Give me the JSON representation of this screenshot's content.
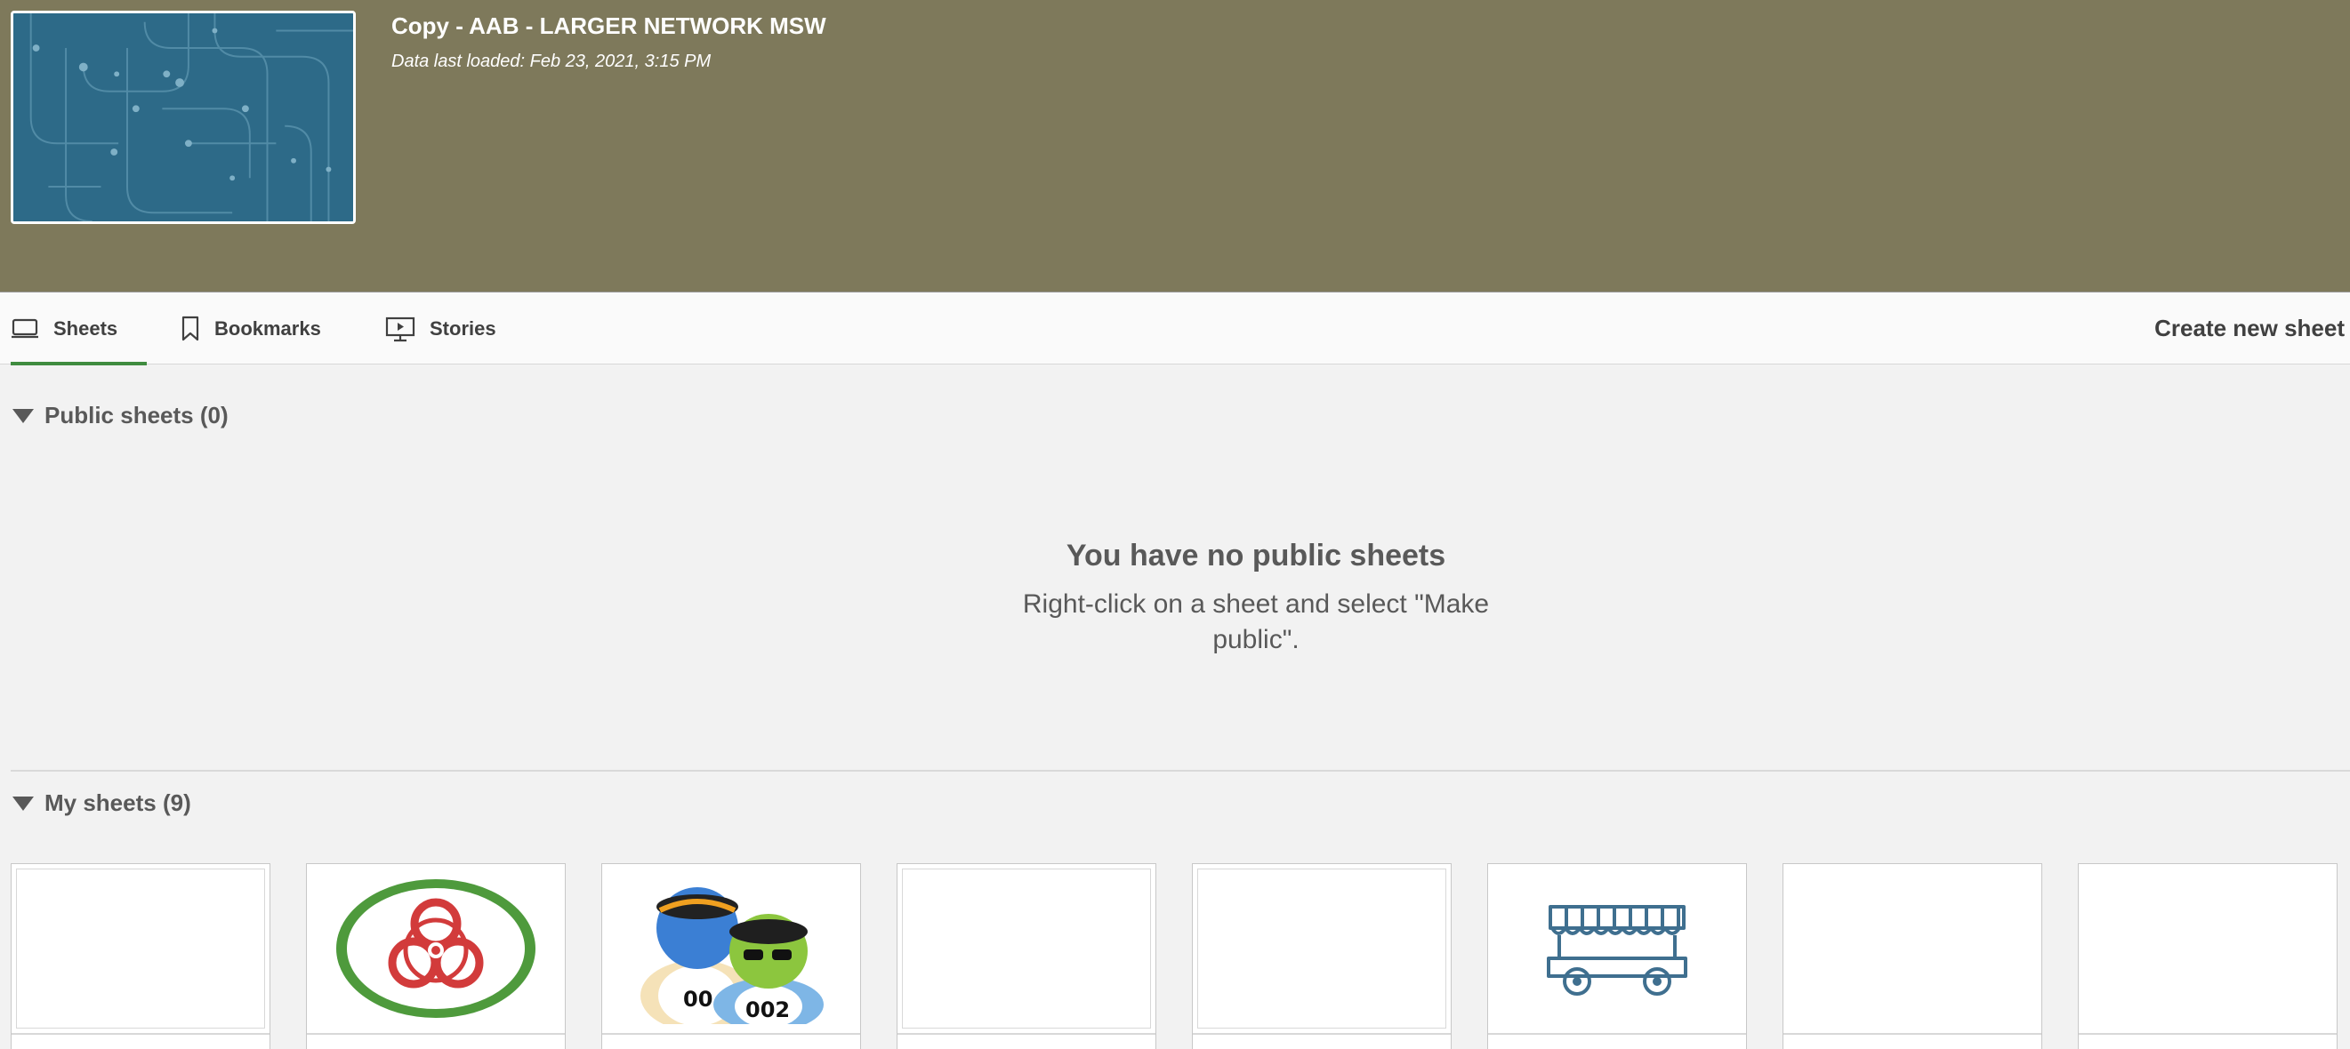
{
  "app": {
    "title": "Copy - AAB - LARGER NETWORK MSW",
    "data_loaded": "Data last loaded: Feb 23, 2021, 3:15 PM"
  },
  "tabs": [
    {
      "label": "Sheets",
      "icon": "sheet-icon",
      "active": true
    },
    {
      "label": "Bookmarks",
      "icon": "bookmark-icon",
      "active": false
    },
    {
      "label": "Stories",
      "icon": "story-icon",
      "active": false
    }
  ],
  "create_new_sheet": "Create new sheet",
  "public_sheets": {
    "heading": "Public sheets (0)",
    "empty_title": "You have no public sheets",
    "empty_message": "Right-click on a sheet and select \"Make public\"."
  },
  "my_sheets": {
    "heading": "My sheets (9)",
    "cards": [
      {
        "thumbnail": "blank"
      },
      {
        "thumbnail": "biohazard-icon"
      },
      {
        "thumbnail": "users-icon",
        "badges": [
          "00",
          "002"
        ]
      },
      {
        "thumbnail": "blank"
      },
      {
        "thumbnail": "blank"
      },
      {
        "thumbnail": "food-cart-icon"
      },
      {
        "thumbnail": "blank"
      },
      {
        "thumbnail": "blank"
      }
    ]
  },
  "colors": {
    "header_bg": "#7e795b",
    "thumbnail_bg": "#2d6a88",
    "active_tab_underline": "#3f8c3f",
    "page_bg": "#f2f2f2"
  }
}
